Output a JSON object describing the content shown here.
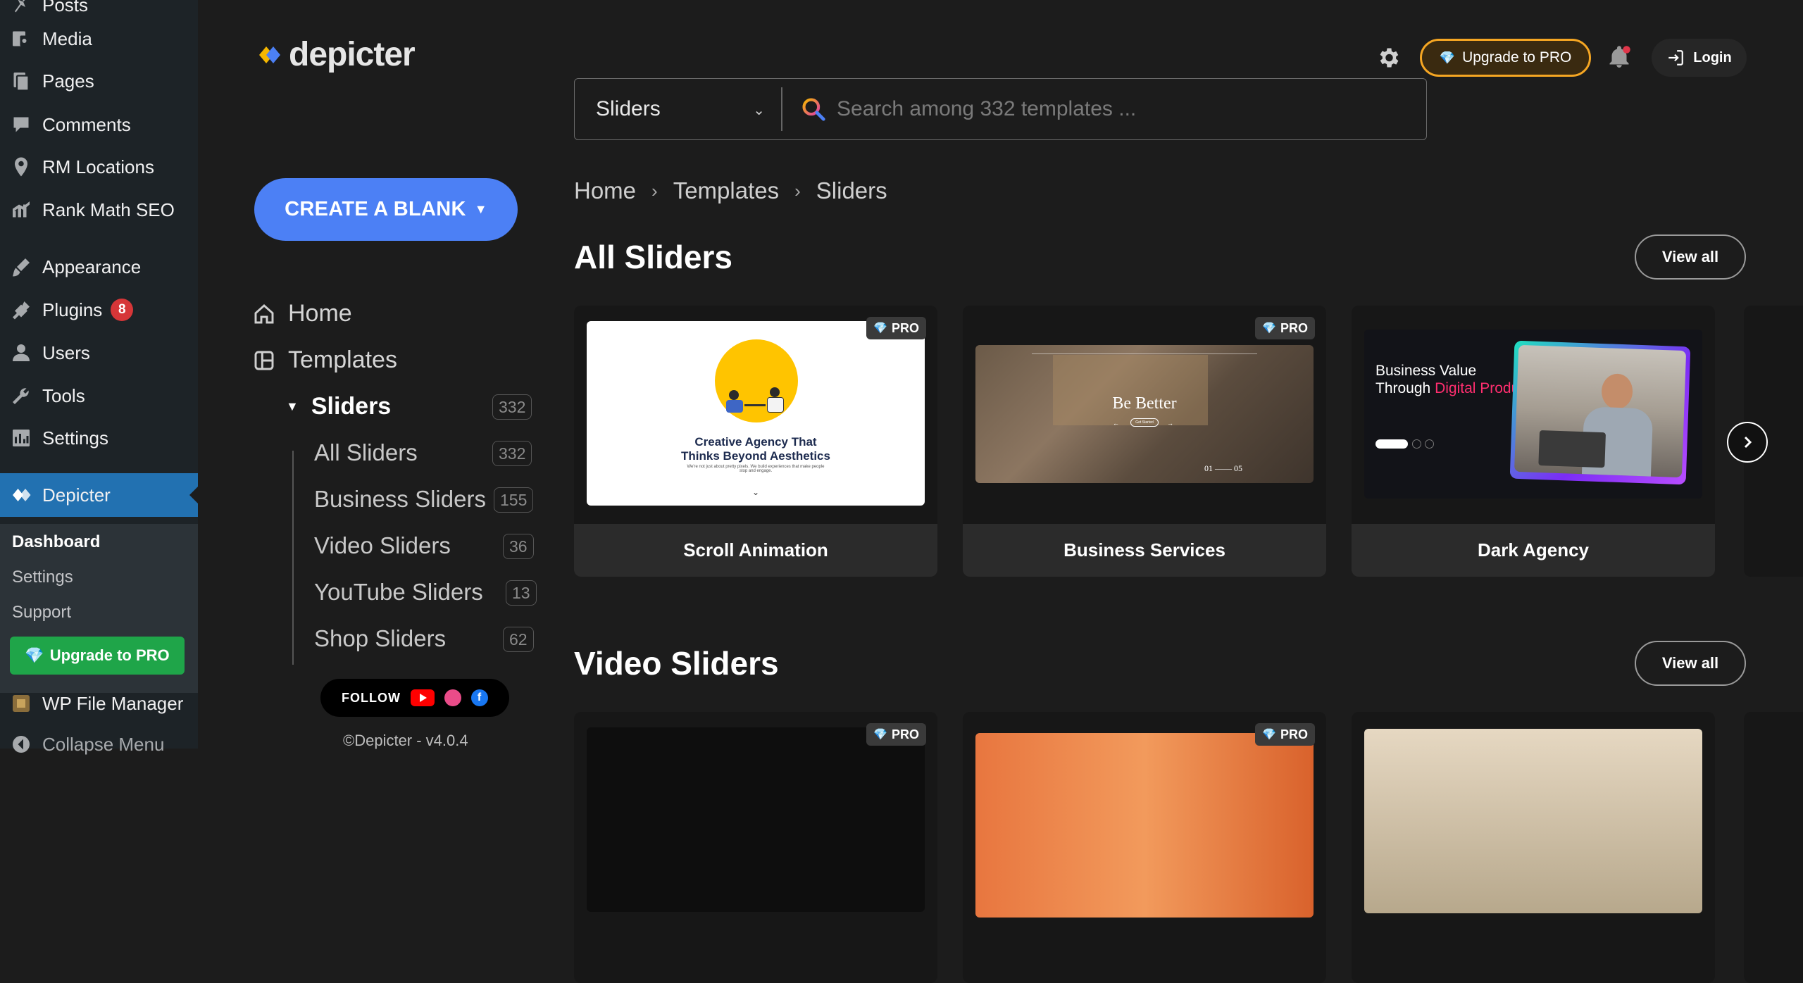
{
  "wp_menu": {
    "items": [
      {
        "label": "Posts",
        "icon": "pin-icon"
      },
      {
        "label": "Media",
        "icon": "media-icon"
      },
      {
        "label": "Pages",
        "icon": "pages-icon"
      },
      {
        "label": "Comments",
        "icon": "comments-icon"
      },
      {
        "label": "RM Locations",
        "icon": "location-icon"
      },
      {
        "label": "Rank Math SEO",
        "icon": "chart-icon"
      },
      {
        "label": "Appearance",
        "icon": "brush-icon"
      },
      {
        "label": "Plugins",
        "icon": "plugin-icon",
        "badge": "8"
      },
      {
        "label": "Users",
        "icon": "user-icon"
      },
      {
        "label": "Tools",
        "icon": "wrench-icon"
      },
      {
        "label": "Settings",
        "icon": "settings-icon"
      },
      {
        "label": "Depicter",
        "icon": "depicter-icon"
      },
      {
        "label": "WP File Manager",
        "icon": "file-manager-icon"
      },
      {
        "label": "Collapse Menu",
        "icon": "collapse-icon"
      }
    ],
    "submenu": [
      "Dashboard",
      "Settings",
      "Support"
    ],
    "upgrade_label": "Upgrade to PRO"
  },
  "app": {
    "logo_text": "depicter",
    "create_label": "CREATE A BLANK",
    "nav": {
      "home": "Home",
      "templates": "Templates",
      "sliders": "Sliders",
      "sliders_count": "332",
      "sub": [
        {
          "label": "All Sliders",
          "count": "332"
        },
        {
          "label": "Business Sliders",
          "count": "155"
        },
        {
          "label": "Video Sliders",
          "count": "36"
        },
        {
          "label": "YouTube Sliders",
          "count": "13"
        },
        {
          "label": "Shop Sliders",
          "count": "62"
        }
      ]
    },
    "follow_label": "FOLLOW",
    "copyright": "©Depicter - v4.0.4"
  },
  "header": {
    "select_value": "Sliders",
    "search_placeholder": "Search among 332 templates ...",
    "upgrade_label": "Upgrade to PRO",
    "login_label": "Login"
  },
  "breadcrumb": [
    "Home",
    "Templates",
    "Sliders"
  ],
  "sections": [
    {
      "title": "All Sliders",
      "view_all": "View all",
      "cards": [
        {
          "label": "Scroll Animation",
          "pro": "PRO",
          "headline": "Creative Agency That Thinks Beyond Aesthetics",
          "sub": "We're not just about pretty pixels. We build experiences that make people stop and engage."
        },
        {
          "label": "Business Services",
          "pro": "PRO",
          "headline": "Be Better",
          "cta": "Get Started",
          "pager": "01 —— 05"
        },
        {
          "label": "Dark Agency",
          "pro": "PRO",
          "headline_1": "Business Value",
          "headline_2": "Through",
          "headline_accent": "Digital Products"
        }
      ]
    },
    {
      "title": "Video Sliders",
      "view_all": "View all",
      "cards": [
        {
          "pro": "PRO"
        },
        {
          "pro": "PRO"
        },
        {}
      ]
    }
  ],
  "colors": {
    "wp_active": "#2271b1",
    "accent_blue": "#4c80f5",
    "upgrade_green": "#1fa549",
    "upgrade_orange": "#f5a623",
    "plugin_badge": "#d63638"
  }
}
